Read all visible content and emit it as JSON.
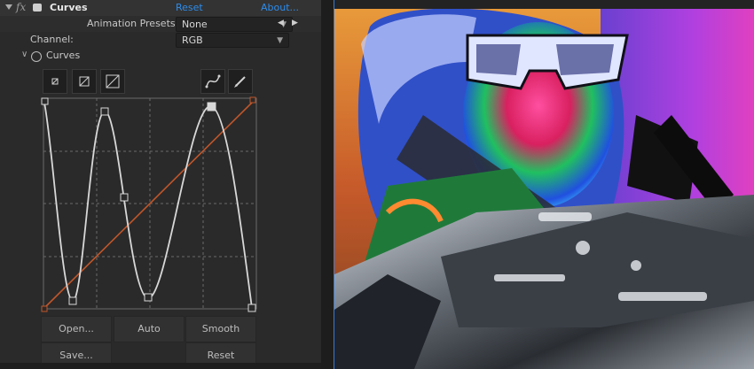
{
  "effect": {
    "name": "Curves",
    "fx_symbol": "fx",
    "reset_label": "Reset",
    "about_label": "About..."
  },
  "presets": {
    "label": "Animation Presets:",
    "value": "None"
  },
  "channel": {
    "label": "Channel:",
    "value": "RGB"
  },
  "curves": {
    "label": "Curves"
  },
  "toolbar": {
    "small": "⊡",
    "medium": "⊘",
    "large": "⊘",
    "bezier": "∿",
    "pencil": "✎"
  },
  "buttons": {
    "open": "Open...",
    "auto": "Auto",
    "smooth": "Smooth",
    "save": "Save...",
    "reset": "Reset"
  },
  "colors": {
    "accent_link": "#2d8ceb",
    "diagonal": "#c0562a",
    "curve": "#d8d8d8"
  }
}
